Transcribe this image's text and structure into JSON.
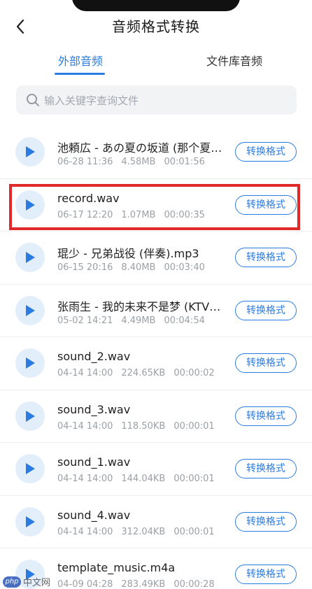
{
  "header": {
    "title": "音频格式转换"
  },
  "tabs": [
    {
      "label": "外部音频",
      "active": true
    },
    {
      "label": "文件库音频",
      "active": false
    }
  ],
  "search": {
    "placeholder": "输入关键字查询文件"
  },
  "files": [
    {
      "name": "池頼広 - あの夏の坂道 (那个夏…",
      "date": "06-28 11:36",
      "size": "4.58MB",
      "duration": "00:01:56",
      "action": "转换格式"
    },
    {
      "name": "record.wav",
      "date": "06-17 12:20",
      "size": "1.07MB",
      "duration": "00:00:35",
      "action": "转换格式",
      "highlighted": true
    },
    {
      "name": "琨少 - 兄弟战役 (伴奏).mp3",
      "date": "06-15 20:16",
      "size": "8.40MB",
      "duration": "00:03:40",
      "action": "转换格式"
    },
    {
      "name": "张雨生 - 我的未来不是梦 (KTV…",
      "date": "05-02 14:21",
      "size": "4.49MB",
      "duration": "00:04:54",
      "action": "转换格式"
    },
    {
      "name": "sound_2.wav",
      "date": "04-14 14:00",
      "size": "224.65KB",
      "duration": "00:00:02",
      "action": "转换格式"
    },
    {
      "name": "sound_3.wav",
      "date": "04-14 14:00",
      "size": "118.50KB",
      "duration": "00:00:01",
      "action": "转换格式"
    },
    {
      "name": "sound_1.wav",
      "date": "04-14 14:00",
      "size": "144.04KB",
      "duration": "00:00:01",
      "action": "转换格式"
    },
    {
      "name": "sound_4.wav",
      "date": "04-14 14:00",
      "size": "312.04KB",
      "duration": "00:00:01",
      "action": "转换格式"
    },
    {
      "name": "template_music.m4a",
      "date": "04-09 04:28",
      "size": "283.49KB",
      "duration": "00:00:28",
      "action": "转换格式"
    }
  ],
  "watermark": {
    "logo": "php",
    "text": "中文网"
  },
  "colors": {
    "accent": "#2b7ce0",
    "highlight": "#e02a2a"
  },
  "icons": {
    "back": "chevron-left-icon",
    "search": "search-icon",
    "play": "play-icon"
  }
}
